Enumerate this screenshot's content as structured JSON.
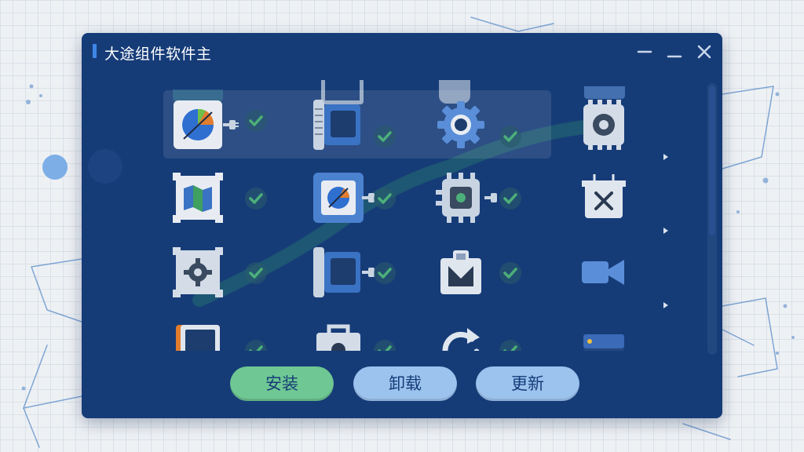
{
  "window": {
    "title": "大途组件软件主"
  },
  "components": [
    {
      "row": 1,
      "col": 1,
      "icon": "pie-chart-icon",
      "status": "installed"
    },
    {
      "row": 1,
      "col": 2,
      "icon": "module-card-icon",
      "status": "installed"
    },
    {
      "row": 1,
      "col": 3,
      "icon": "gear-icon",
      "status": "installed"
    },
    {
      "row": 1,
      "col": 4,
      "icon": "chip-gear-icon",
      "status": "expandable"
    },
    {
      "row": 2,
      "col": 1,
      "icon": "map-icon",
      "status": "installed"
    },
    {
      "row": 2,
      "col": 2,
      "icon": "chart-app-icon",
      "status": "installed"
    },
    {
      "row": 2,
      "col": 3,
      "icon": "chip-icon",
      "status": "installed"
    },
    {
      "row": 2,
      "col": 4,
      "icon": "tools-box-icon",
      "status": "expandable"
    },
    {
      "row": 3,
      "col": 1,
      "icon": "settings-panel-icon",
      "status": "installed"
    },
    {
      "row": 3,
      "col": 2,
      "icon": "card-connector-icon",
      "status": "installed"
    },
    {
      "row": 3,
      "col": 3,
      "icon": "package-icon",
      "status": "installed"
    },
    {
      "row": 3,
      "col": 4,
      "icon": "video-camera-icon",
      "status": "expandable"
    },
    {
      "row": 4,
      "col": 1,
      "icon": "document-icon",
      "status": "installed"
    },
    {
      "row": 4,
      "col": 2,
      "icon": "bag-icon",
      "status": "installed"
    },
    {
      "row": 4,
      "col": 3,
      "icon": "refresh-icon",
      "status": "installed"
    },
    {
      "row": 4,
      "col": 4,
      "icon": "server-icon",
      "status": "expandable"
    }
  ],
  "colors": {
    "window_bg": "#163c78",
    "accent": "#3f86e8",
    "check_green": "#4caf7a",
    "install_button": "#6fc893",
    "secondary_button": "#9cc2ee"
  },
  "actions": {
    "install": "安装",
    "uninstall": "卸载",
    "update": "更新"
  }
}
